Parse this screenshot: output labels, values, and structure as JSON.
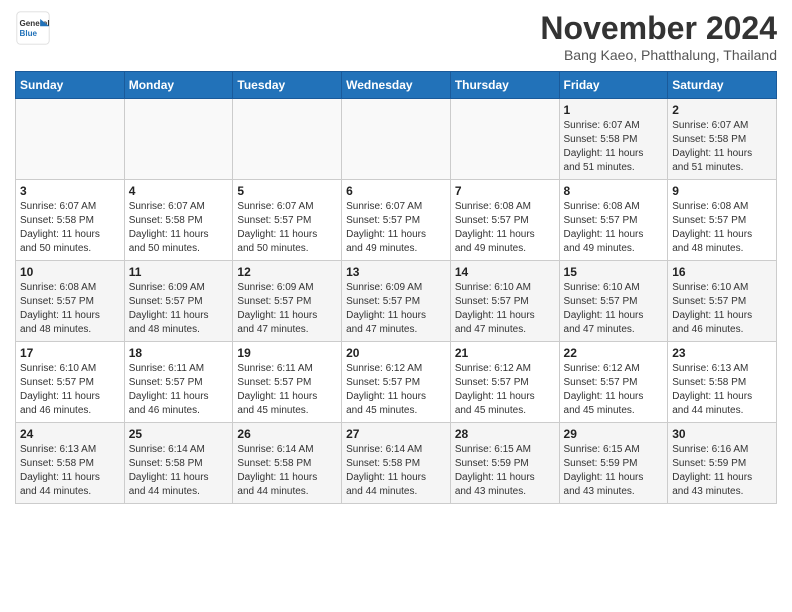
{
  "header": {
    "logo_line1": "General",
    "logo_line2": "Blue",
    "month": "November 2024",
    "location": "Bang Kaeo, Phatthalung, Thailand"
  },
  "weekdays": [
    "Sunday",
    "Monday",
    "Tuesday",
    "Wednesday",
    "Thursday",
    "Friday",
    "Saturday"
  ],
  "weeks": [
    [
      {
        "day": "",
        "info": ""
      },
      {
        "day": "",
        "info": ""
      },
      {
        "day": "",
        "info": ""
      },
      {
        "day": "",
        "info": ""
      },
      {
        "day": "",
        "info": ""
      },
      {
        "day": "1",
        "info": "Sunrise: 6:07 AM\nSunset: 5:58 PM\nDaylight: 11 hours\nand 51 minutes."
      },
      {
        "day": "2",
        "info": "Sunrise: 6:07 AM\nSunset: 5:58 PM\nDaylight: 11 hours\nand 51 minutes."
      }
    ],
    [
      {
        "day": "3",
        "info": "Sunrise: 6:07 AM\nSunset: 5:58 PM\nDaylight: 11 hours\nand 50 minutes."
      },
      {
        "day": "4",
        "info": "Sunrise: 6:07 AM\nSunset: 5:58 PM\nDaylight: 11 hours\nand 50 minutes."
      },
      {
        "day": "5",
        "info": "Sunrise: 6:07 AM\nSunset: 5:57 PM\nDaylight: 11 hours\nand 50 minutes."
      },
      {
        "day": "6",
        "info": "Sunrise: 6:07 AM\nSunset: 5:57 PM\nDaylight: 11 hours\nand 49 minutes."
      },
      {
        "day": "7",
        "info": "Sunrise: 6:08 AM\nSunset: 5:57 PM\nDaylight: 11 hours\nand 49 minutes."
      },
      {
        "day": "8",
        "info": "Sunrise: 6:08 AM\nSunset: 5:57 PM\nDaylight: 11 hours\nand 49 minutes."
      },
      {
        "day": "9",
        "info": "Sunrise: 6:08 AM\nSunset: 5:57 PM\nDaylight: 11 hours\nand 48 minutes."
      }
    ],
    [
      {
        "day": "10",
        "info": "Sunrise: 6:08 AM\nSunset: 5:57 PM\nDaylight: 11 hours\nand 48 minutes."
      },
      {
        "day": "11",
        "info": "Sunrise: 6:09 AM\nSunset: 5:57 PM\nDaylight: 11 hours\nand 48 minutes."
      },
      {
        "day": "12",
        "info": "Sunrise: 6:09 AM\nSunset: 5:57 PM\nDaylight: 11 hours\nand 47 minutes."
      },
      {
        "day": "13",
        "info": "Sunrise: 6:09 AM\nSunset: 5:57 PM\nDaylight: 11 hours\nand 47 minutes."
      },
      {
        "day": "14",
        "info": "Sunrise: 6:10 AM\nSunset: 5:57 PM\nDaylight: 11 hours\nand 47 minutes."
      },
      {
        "day": "15",
        "info": "Sunrise: 6:10 AM\nSunset: 5:57 PM\nDaylight: 11 hours\nand 47 minutes."
      },
      {
        "day": "16",
        "info": "Sunrise: 6:10 AM\nSunset: 5:57 PM\nDaylight: 11 hours\nand 46 minutes."
      }
    ],
    [
      {
        "day": "17",
        "info": "Sunrise: 6:10 AM\nSunset: 5:57 PM\nDaylight: 11 hours\nand 46 minutes."
      },
      {
        "day": "18",
        "info": "Sunrise: 6:11 AM\nSunset: 5:57 PM\nDaylight: 11 hours\nand 46 minutes."
      },
      {
        "day": "19",
        "info": "Sunrise: 6:11 AM\nSunset: 5:57 PM\nDaylight: 11 hours\nand 45 minutes."
      },
      {
        "day": "20",
        "info": "Sunrise: 6:12 AM\nSunset: 5:57 PM\nDaylight: 11 hours\nand 45 minutes."
      },
      {
        "day": "21",
        "info": "Sunrise: 6:12 AM\nSunset: 5:57 PM\nDaylight: 11 hours\nand 45 minutes."
      },
      {
        "day": "22",
        "info": "Sunrise: 6:12 AM\nSunset: 5:57 PM\nDaylight: 11 hours\nand 45 minutes."
      },
      {
        "day": "23",
        "info": "Sunrise: 6:13 AM\nSunset: 5:58 PM\nDaylight: 11 hours\nand 44 minutes."
      }
    ],
    [
      {
        "day": "24",
        "info": "Sunrise: 6:13 AM\nSunset: 5:58 PM\nDaylight: 11 hours\nand 44 minutes."
      },
      {
        "day": "25",
        "info": "Sunrise: 6:14 AM\nSunset: 5:58 PM\nDaylight: 11 hours\nand 44 minutes."
      },
      {
        "day": "26",
        "info": "Sunrise: 6:14 AM\nSunset: 5:58 PM\nDaylight: 11 hours\nand 44 minutes."
      },
      {
        "day": "27",
        "info": "Sunrise: 6:14 AM\nSunset: 5:58 PM\nDaylight: 11 hours\nand 44 minutes."
      },
      {
        "day": "28",
        "info": "Sunrise: 6:15 AM\nSunset: 5:59 PM\nDaylight: 11 hours\nand 43 minutes."
      },
      {
        "day": "29",
        "info": "Sunrise: 6:15 AM\nSunset: 5:59 PM\nDaylight: 11 hours\nand 43 minutes."
      },
      {
        "day": "30",
        "info": "Sunrise: 6:16 AM\nSunset: 5:59 PM\nDaylight: 11 hours\nand 43 minutes."
      }
    ]
  ]
}
